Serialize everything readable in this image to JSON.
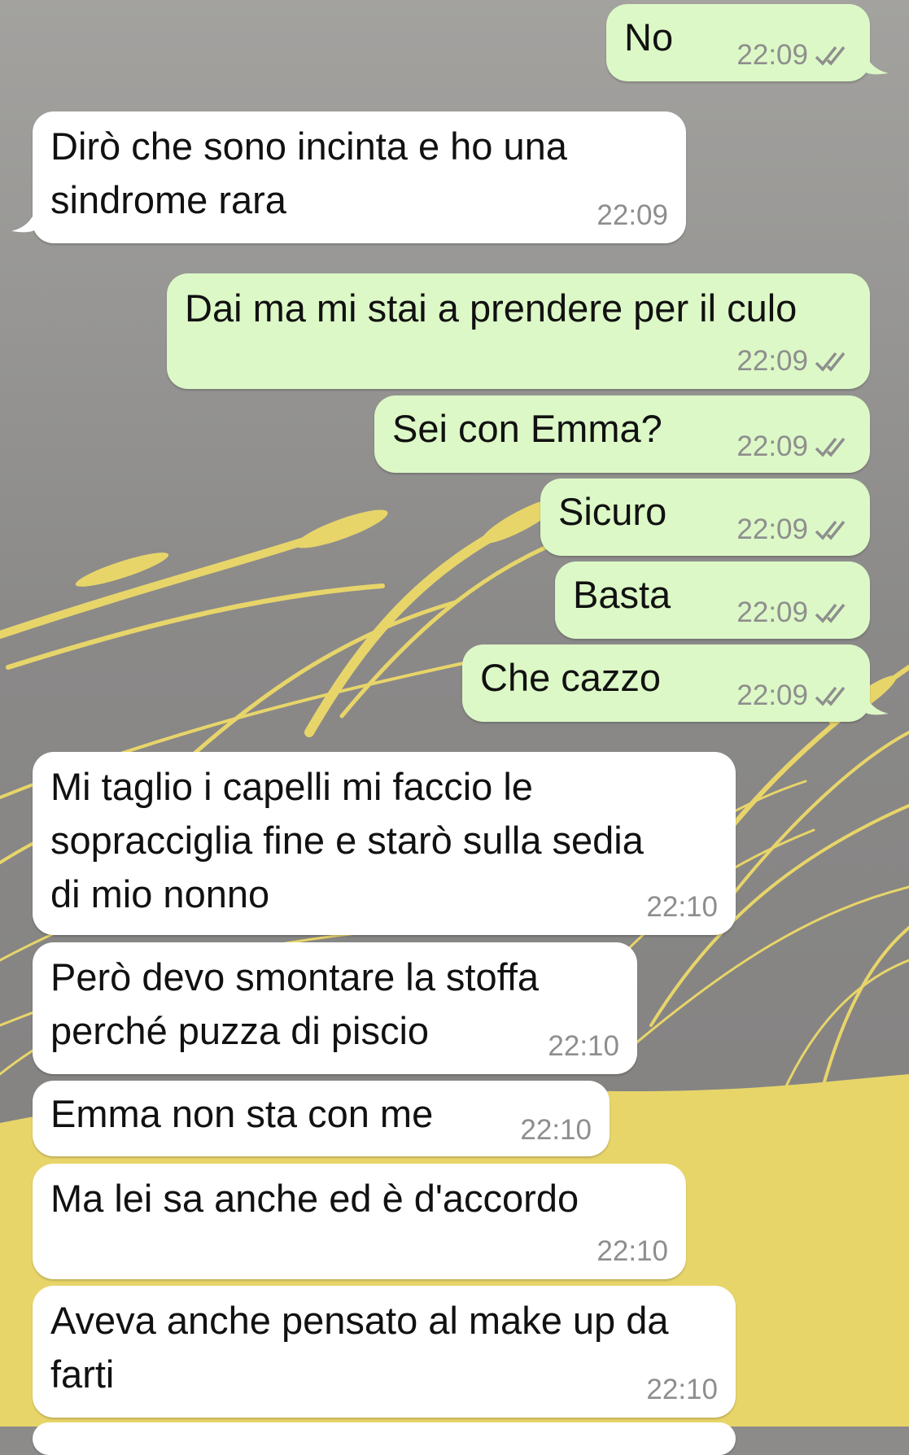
{
  "messages": [
    {
      "dir": "out",
      "text": "No",
      "time": "22:09",
      "status": "read-double-check-icon"
    },
    {
      "dir": "in",
      "text": "Dirò che sono incinta e ho una\nsindrome rara",
      "time": "22:09"
    },
    {
      "dir": "out",
      "text": "Dai ma mi stai a prendere per il culo",
      "time": "22:09",
      "status": "read-double-check-icon"
    },
    {
      "dir": "out",
      "text": "Sei con Emma?",
      "time": "22:09",
      "status": "read-double-check-icon"
    },
    {
      "dir": "out",
      "text": "Sicuro",
      "time": "22:09",
      "status": "read-double-check-icon"
    },
    {
      "dir": "out",
      "text": "Basta",
      "time": "22:09",
      "status": "read-double-check-icon"
    },
    {
      "dir": "out",
      "text": "Che cazzo",
      "time": "22:09",
      "status": "read-double-check-icon"
    },
    {
      "dir": "in",
      "text": "Mi taglio i capelli mi faccio le\nsopracciglia fine e starò sulla sedia\ndi mio nonno",
      "time": "22:10"
    },
    {
      "dir": "in",
      "text": "Però devo smontare la stoffa\nperché puzza di piscio",
      "time": "22:10"
    },
    {
      "dir": "in",
      "text": "Emma non sta con me",
      "time": "22:10"
    },
    {
      "dir": "in",
      "text": "Ma lei sa anche ed è d'accordo",
      "time": "22:10"
    },
    {
      "dir": "in",
      "text": "Aveva anche pensato al make up da\nfarti",
      "time": "22:10"
    }
  ],
  "colors": {
    "outgoing_bubble": "#dcf8c6",
    "incoming_bubble": "#ffffff",
    "wallpaper_gray": "#8c8b89",
    "wallpaper_wheat": "#e8d56a",
    "timestamp": "#8e8e8e"
  }
}
